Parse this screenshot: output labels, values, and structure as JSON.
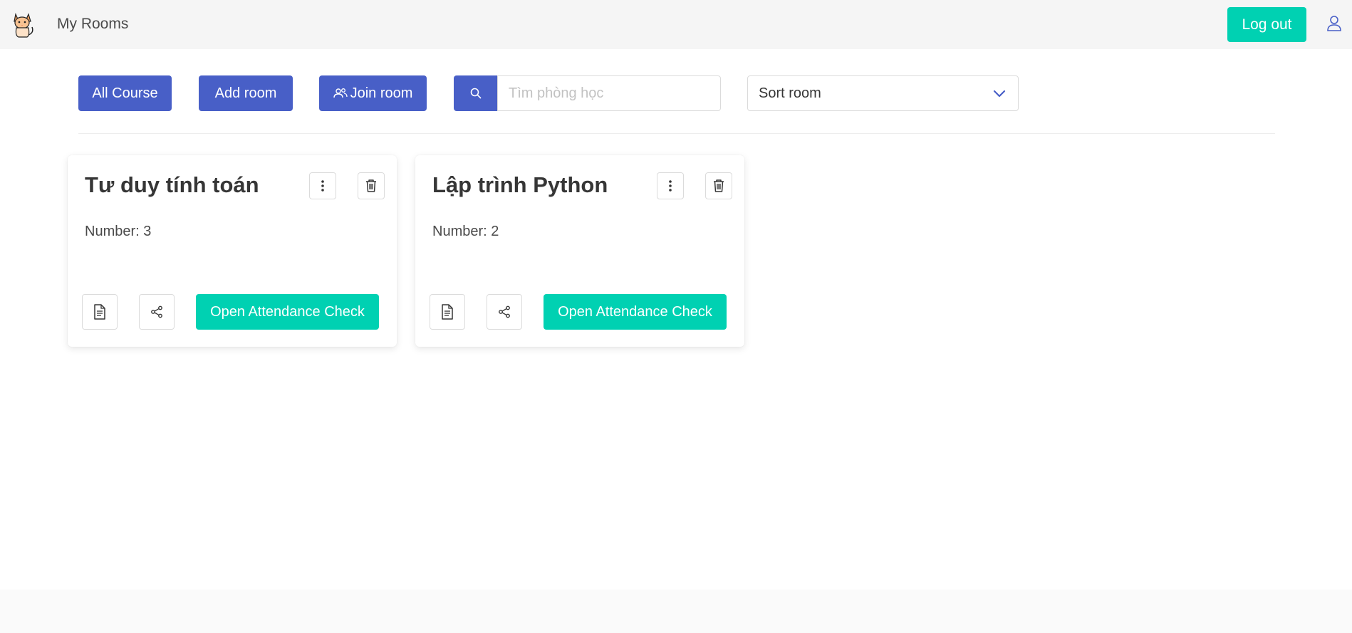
{
  "nav": {
    "title": "My Rooms",
    "logout_label": "Log out",
    "logo_icon": "cat-logo-icon",
    "user_icon": "user-icon"
  },
  "toolbar": {
    "all_course_label": "All Course",
    "add_room_label": "Add room",
    "join_room_label": "Join room",
    "search_placeholder": "Tìm phòng học",
    "search_value": "",
    "sort_label": "Sort room"
  },
  "rooms": [
    {
      "title": "Tư duy tính toán",
      "number_label": "Number: 3",
      "attend_label": "Open Attendance Check"
    },
    {
      "title": "Lập trình Python",
      "number_label": "Number: 2",
      "attend_label": "Open Attendance Check"
    }
  ],
  "colors": {
    "primary": "#485fc7",
    "success": "#00d1b2",
    "nav_bg": "#f5f5f5"
  }
}
